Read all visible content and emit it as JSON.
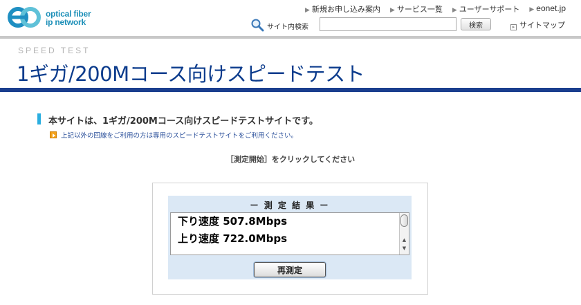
{
  "header": {
    "logo": {
      "text_line1": "optical fiber",
      "text_line2": "ip network",
      "icon": "eo-logo-icon"
    },
    "nav": [
      {
        "label": "新規お申し込み案内"
      },
      {
        "label": "サービス一覧"
      },
      {
        "label": "ユーザーサポート"
      },
      {
        "label": "eonet.jp"
      }
    ],
    "search": {
      "icon": "search-icon",
      "label": "サイト内検索",
      "value": "",
      "placeholder": "",
      "button_label": "検索"
    },
    "sitemap_label": "サイトマップ"
  },
  "title": {
    "sub": "SPEED TEST",
    "main": "1ギガ/200Mコース向けスピードテスト"
  },
  "content": {
    "lead": "本サイトは、1ギガ/200Mコース向けスピードテストサイトです。",
    "note": "上記以外の回線をご利用の方は専用のスピードテストサイトをご利用ください。",
    "instruction": "［測定開始］をクリックしてください"
  },
  "result": {
    "title": "ー 測 定 結 果 ー",
    "lines": [
      "下り速度 507.8Mbps",
      "上り速度 722.0Mbps"
    ],
    "retest_label": "再測定"
  },
  "colors": {
    "title_blue": "#0b3b8c",
    "accent_bar": "#1a3e8e",
    "lead_mark": "#2aaee0",
    "panel_bg": "#dbe8f5",
    "note_link": "#2a4f9a"
  }
}
